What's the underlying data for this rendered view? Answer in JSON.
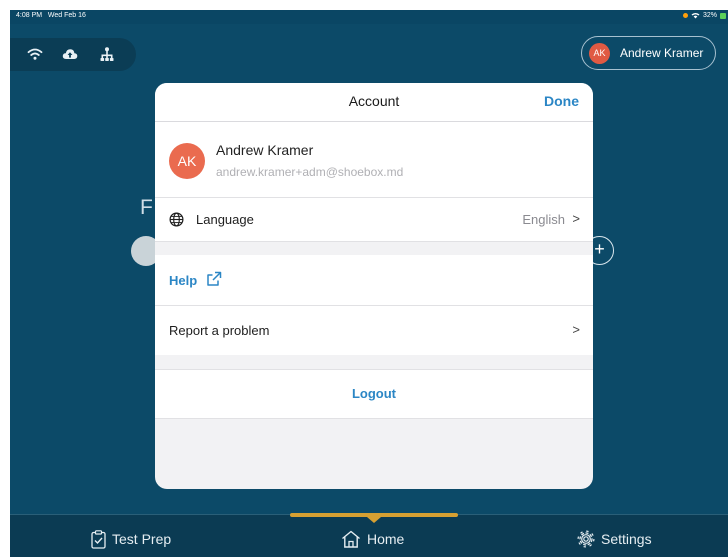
{
  "status_bar": {
    "time": "4:08 PM",
    "date": "Wed Feb 16",
    "battery": "32%"
  },
  "header": {
    "connection_icons": [
      "wifi-icon",
      "cloud-upload-icon",
      "network-icon"
    ],
    "user": {
      "initials": "AK",
      "name": "Andrew Kramer"
    }
  },
  "background": {
    "title_fragment": "F"
  },
  "modal": {
    "title": "Account",
    "done_label": "Done",
    "profile": {
      "initials": "AK",
      "name": "Andrew Kramer",
      "email": "andrew.kramer+adm@shoebox.md"
    },
    "language": {
      "label": "Language",
      "value": "English",
      "chevron": ">"
    },
    "help_label": "Help",
    "report_label": "Report a problem",
    "report_chevron": ">",
    "logout_label": "Logout"
  },
  "tab_bar": {
    "tabs": [
      {
        "label": "Test Prep",
        "icon": "clipboard-check-icon"
      },
      {
        "label": "Home",
        "icon": "home-icon"
      },
      {
        "label": "Settings",
        "icon": "gear-icon"
      }
    ],
    "active_tab": "Home"
  },
  "colors": {
    "background": "#0c4a68",
    "accent": "#2b86c5",
    "indicator": "#d6a032",
    "avatar": "#ea6b4f"
  }
}
